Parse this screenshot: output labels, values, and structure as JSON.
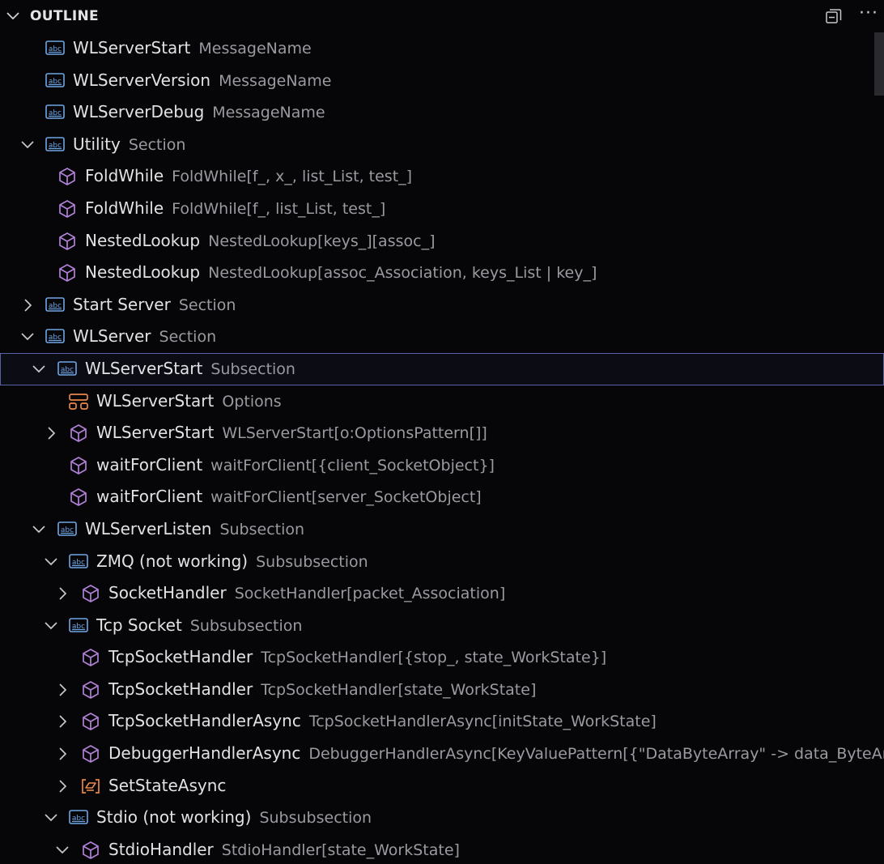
{
  "header": {
    "title": "OUTLINE",
    "more_label": "···"
  },
  "colors": {
    "string_icon": "#6fa6e6",
    "function_icon": "#b180d7",
    "options_icon": "#e8874a",
    "variable_icon": "#e8874a"
  },
  "tree": [
    {
      "name": "WLServerStart",
      "detail": "MessageName",
      "icon": "string-icon",
      "twistie": "none"
    },
    {
      "name": "WLServerVersion",
      "detail": "MessageName",
      "icon": "string-icon",
      "twistie": "none"
    },
    {
      "name": "WLServerDebug",
      "detail": "MessageName",
      "icon": "string-icon",
      "twistie": "none"
    },
    {
      "name": "Utility",
      "detail": "Section",
      "icon": "string-icon",
      "twistie": "expanded"
    },
    {
      "name": "FoldWhile",
      "detail": "FoldWhile[f_, x_, list_List, test_]",
      "icon": "function-icon",
      "twistie": "none"
    },
    {
      "name": "FoldWhile",
      "detail": "FoldWhile[f_, list_List, test_]",
      "icon": "function-icon",
      "twistie": "none"
    },
    {
      "name": "NestedLookup",
      "detail": "NestedLookup[keys_][assoc_]",
      "icon": "function-icon",
      "twistie": "none"
    },
    {
      "name": "NestedLookup",
      "detail": "NestedLookup[assoc_Association, keys_List | key_]",
      "icon": "function-icon",
      "twistie": "none"
    },
    {
      "name": "Start Server",
      "detail": "Section",
      "icon": "string-icon",
      "twistie": "collapsed"
    },
    {
      "name": "WLServer",
      "detail": "Section",
      "icon": "string-icon",
      "twistie": "expanded"
    },
    {
      "name": "WLServerStart",
      "detail": "Subsection",
      "icon": "string-icon",
      "twistie": "expanded",
      "selected": true
    },
    {
      "name": "WLServerStart",
      "detail": "Options",
      "icon": "options-icon",
      "twistie": "none"
    },
    {
      "name": "WLServerStart",
      "detail": "WLServerStart[o:OptionsPattern[]]",
      "icon": "function-icon",
      "twistie": "collapsed"
    },
    {
      "name": "waitForClient",
      "detail": "waitForClient[{client_SocketObject}]",
      "icon": "function-icon",
      "twistie": "none"
    },
    {
      "name": "waitForClient",
      "detail": "waitForClient[server_SocketObject]",
      "icon": "function-icon",
      "twistie": "none"
    },
    {
      "name": "WLServerListen",
      "detail": "Subsection",
      "icon": "string-icon",
      "twistie": "expanded"
    },
    {
      "name": "ZMQ  (not working)",
      "detail": "Subsubsection",
      "icon": "string-icon",
      "twistie": "expanded"
    },
    {
      "name": "SocketHandler",
      "detail": "SocketHandler[packet_Association]",
      "icon": "function-icon",
      "twistie": "collapsed"
    },
    {
      "name": "Tcp Socket",
      "detail": "Subsubsection",
      "icon": "string-icon",
      "twistie": "expanded"
    },
    {
      "name": "TcpSocketHandler",
      "detail": "TcpSocketHandler[{stop_, state_WorkState}]",
      "icon": "function-icon",
      "twistie": "none"
    },
    {
      "name": "TcpSocketHandler",
      "detail": "TcpSocketHandler[state_WorkState]",
      "icon": "function-icon",
      "twistie": "collapsed"
    },
    {
      "name": "TcpSocketHandlerAsync",
      "detail": "TcpSocketHandlerAsync[initState_WorkState]",
      "icon": "function-icon",
      "twistie": "collapsed"
    },
    {
      "name": "DebuggerHandlerAsync",
      "detail": "DebuggerHandlerAsync[KeyValuePattern[{\"DataByteArray\" -> data_ByteAr...",
      "icon": "function-icon",
      "twistie": "collapsed"
    },
    {
      "name": "SetStateAsync",
      "detail": "",
      "icon": "variable-icon",
      "twistie": "collapsed"
    },
    {
      "name": "Stdio (not working)",
      "detail": "Subsubsection",
      "icon": "string-icon",
      "twistie": "expanded"
    },
    {
      "name": "StdioHandler",
      "detail": "StdioHandler[state_WorkState]",
      "icon": "function-icon",
      "twistie": "expanded"
    }
  ]
}
